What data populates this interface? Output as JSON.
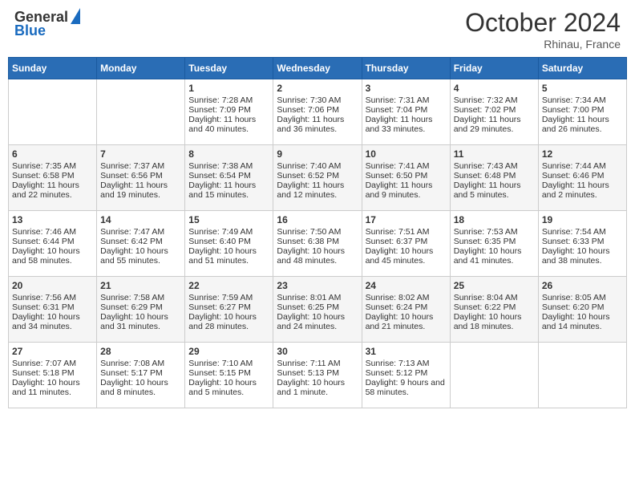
{
  "header": {
    "logo_general": "General",
    "logo_blue": "Blue",
    "month_title": "October 2024",
    "location": "Rhinau, France"
  },
  "weekdays": [
    "Sunday",
    "Monday",
    "Tuesday",
    "Wednesday",
    "Thursday",
    "Friday",
    "Saturday"
  ],
  "weeks": [
    [
      {
        "day": "",
        "sunrise": "",
        "sunset": "",
        "daylight": ""
      },
      {
        "day": "",
        "sunrise": "",
        "sunset": "",
        "daylight": ""
      },
      {
        "day": "1",
        "sunrise": "Sunrise: 7:28 AM",
        "sunset": "Sunset: 7:09 PM",
        "daylight": "Daylight: 11 hours and 40 minutes."
      },
      {
        "day": "2",
        "sunrise": "Sunrise: 7:30 AM",
        "sunset": "Sunset: 7:06 PM",
        "daylight": "Daylight: 11 hours and 36 minutes."
      },
      {
        "day": "3",
        "sunrise": "Sunrise: 7:31 AM",
        "sunset": "Sunset: 7:04 PM",
        "daylight": "Daylight: 11 hours and 33 minutes."
      },
      {
        "day": "4",
        "sunrise": "Sunrise: 7:32 AM",
        "sunset": "Sunset: 7:02 PM",
        "daylight": "Daylight: 11 hours and 29 minutes."
      },
      {
        "day": "5",
        "sunrise": "Sunrise: 7:34 AM",
        "sunset": "Sunset: 7:00 PM",
        "daylight": "Daylight: 11 hours and 26 minutes."
      }
    ],
    [
      {
        "day": "6",
        "sunrise": "Sunrise: 7:35 AM",
        "sunset": "Sunset: 6:58 PM",
        "daylight": "Daylight: 11 hours and 22 minutes."
      },
      {
        "day": "7",
        "sunrise": "Sunrise: 7:37 AM",
        "sunset": "Sunset: 6:56 PM",
        "daylight": "Daylight: 11 hours and 19 minutes."
      },
      {
        "day": "8",
        "sunrise": "Sunrise: 7:38 AM",
        "sunset": "Sunset: 6:54 PM",
        "daylight": "Daylight: 11 hours and 15 minutes."
      },
      {
        "day": "9",
        "sunrise": "Sunrise: 7:40 AM",
        "sunset": "Sunset: 6:52 PM",
        "daylight": "Daylight: 11 hours and 12 minutes."
      },
      {
        "day": "10",
        "sunrise": "Sunrise: 7:41 AM",
        "sunset": "Sunset: 6:50 PM",
        "daylight": "Daylight: 11 hours and 9 minutes."
      },
      {
        "day": "11",
        "sunrise": "Sunrise: 7:43 AM",
        "sunset": "Sunset: 6:48 PM",
        "daylight": "Daylight: 11 hours and 5 minutes."
      },
      {
        "day": "12",
        "sunrise": "Sunrise: 7:44 AM",
        "sunset": "Sunset: 6:46 PM",
        "daylight": "Daylight: 11 hours and 2 minutes."
      }
    ],
    [
      {
        "day": "13",
        "sunrise": "Sunrise: 7:46 AM",
        "sunset": "Sunset: 6:44 PM",
        "daylight": "Daylight: 10 hours and 58 minutes."
      },
      {
        "day": "14",
        "sunrise": "Sunrise: 7:47 AM",
        "sunset": "Sunset: 6:42 PM",
        "daylight": "Daylight: 10 hours and 55 minutes."
      },
      {
        "day": "15",
        "sunrise": "Sunrise: 7:49 AM",
        "sunset": "Sunset: 6:40 PM",
        "daylight": "Daylight: 10 hours and 51 minutes."
      },
      {
        "day": "16",
        "sunrise": "Sunrise: 7:50 AM",
        "sunset": "Sunset: 6:38 PM",
        "daylight": "Daylight: 10 hours and 48 minutes."
      },
      {
        "day": "17",
        "sunrise": "Sunrise: 7:51 AM",
        "sunset": "Sunset: 6:37 PM",
        "daylight": "Daylight: 10 hours and 45 minutes."
      },
      {
        "day": "18",
        "sunrise": "Sunrise: 7:53 AM",
        "sunset": "Sunset: 6:35 PM",
        "daylight": "Daylight: 10 hours and 41 minutes."
      },
      {
        "day": "19",
        "sunrise": "Sunrise: 7:54 AM",
        "sunset": "Sunset: 6:33 PM",
        "daylight": "Daylight: 10 hours and 38 minutes."
      }
    ],
    [
      {
        "day": "20",
        "sunrise": "Sunrise: 7:56 AM",
        "sunset": "Sunset: 6:31 PM",
        "daylight": "Daylight: 10 hours and 34 minutes."
      },
      {
        "day": "21",
        "sunrise": "Sunrise: 7:58 AM",
        "sunset": "Sunset: 6:29 PM",
        "daylight": "Daylight: 10 hours and 31 minutes."
      },
      {
        "day": "22",
        "sunrise": "Sunrise: 7:59 AM",
        "sunset": "Sunset: 6:27 PM",
        "daylight": "Daylight: 10 hours and 28 minutes."
      },
      {
        "day": "23",
        "sunrise": "Sunrise: 8:01 AM",
        "sunset": "Sunset: 6:25 PM",
        "daylight": "Daylight: 10 hours and 24 minutes."
      },
      {
        "day": "24",
        "sunrise": "Sunrise: 8:02 AM",
        "sunset": "Sunset: 6:24 PM",
        "daylight": "Daylight: 10 hours and 21 minutes."
      },
      {
        "day": "25",
        "sunrise": "Sunrise: 8:04 AM",
        "sunset": "Sunset: 6:22 PM",
        "daylight": "Daylight: 10 hours and 18 minutes."
      },
      {
        "day": "26",
        "sunrise": "Sunrise: 8:05 AM",
        "sunset": "Sunset: 6:20 PM",
        "daylight": "Daylight: 10 hours and 14 minutes."
      }
    ],
    [
      {
        "day": "27",
        "sunrise": "Sunrise: 7:07 AM",
        "sunset": "Sunset: 5:18 PM",
        "daylight": "Daylight: 10 hours and 11 minutes."
      },
      {
        "day": "28",
        "sunrise": "Sunrise: 7:08 AM",
        "sunset": "Sunset: 5:17 PM",
        "daylight": "Daylight: 10 hours and 8 minutes."
      },
      {
        "day": "29",
        "sunrise": "Sunrise: 7:10 AM",
        "sunset": "Sunset: 5:15 PM",
        "daylight": "Daylight: 10 hours and 5 minutes."
      },
      {
        "day": "30",
        "sunrise": "Sunrise: 7:11 AM",
        "sunset": "Sunset: 5:13 PM",
        "daylight": "Daylight: 10 hours and 1 minute."
      },
      {
        "day": "31",
        "sunrise": "Sunrise: 7:13 AM",
        "sunset": "Sunset: 5:12 PM",
        "daylight": "Daylight: 9 hours and 58 minutes."
      },
      {
        "day": "",
        "sunrise": "",
        "sunset": "",
        "daylight": ""
      },
      {
        "day": "",
        "sunrise": "",
        "sunset": "",
        "daylight": ""
      }
    ]
  ]
}
